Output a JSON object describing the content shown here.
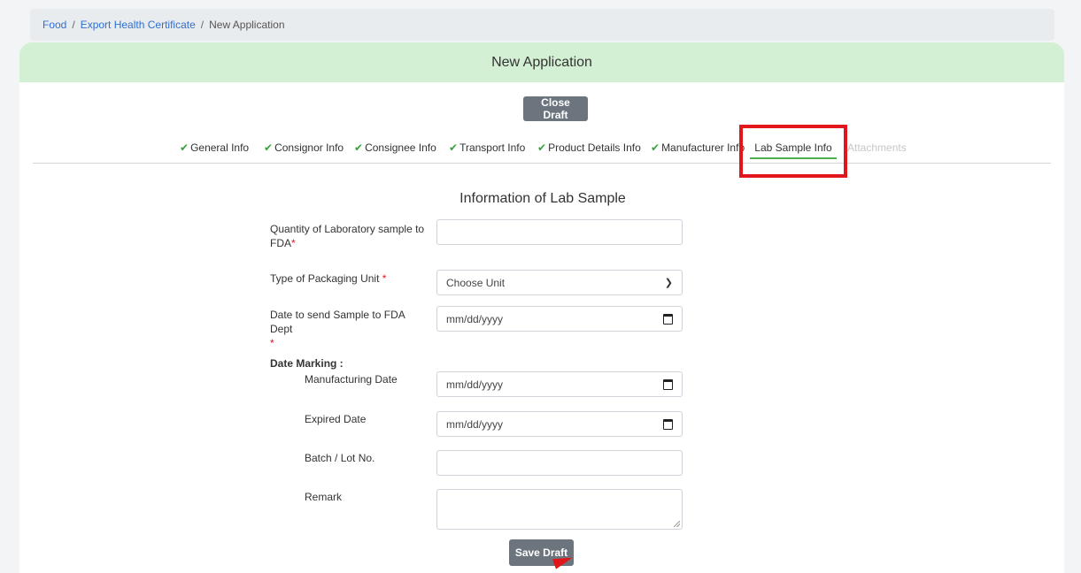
{
  "breadcrumb": {
    "items": [
      "Food",
      "Export Health Certificate"
    ],
    "separator": "/",
    "current": "New Application"
  },
  "header": {
    "title": "New Application"
  },
  "actions": {
    "close_draft_label": "Close Draft",
    "save_draft_label": "Save Draft"
  },
  "tabs": [
    {
      "label": "General Info",
      "completed": true
    },
    {
      "label": "Consignor Info",
      "completed": true
    },
    {
      "label": "Consignee Info",
      "completed": true
    },
    {
      "label": "Transport Info",
      "completed": true
    },
    {
      "label": "Product Details Info",
      "completed": true
    },
    {
      "label": "Manufacturer Info",
      "completed": true
    },
    {
      "label": "Lab Sample Info",
      "active": true
    },
    {
      "label": "Attachments",
      "disabled": true
    }
  ],
  "form": {
    "title": "Information of Lab Sample",
    "required_mark": "*",
    "quantity_label_line1": "Quantity of Laboratory sample to",
    "quantity_label_line2": "FDA",
    "quantity_value": "",
    "packaging_label": "Type of Packaging Unit",
    "packaging_value": "Choose Unit",
    "send_date_label": "Date to send Sample to FDA Dept",
    "send_date_value": "mm/dd/yyyy",
    "date_marking_label": "Date Marking :",
    "manufacturing_date_label": "Manufacturing Date",
    "manufacturing_date_value": "mm/dd/yyyy",
    "expired_date_label": "Expired Date",
    "expired_date_value": "mm/dd/yyyy",
    "batch_label": "Batch / Lot No.",
    "batch_value": "",
    "remark_label": "Remark",
    "remark_value": ""
  },
  "colors": {
    "header_bg": "#d4f0d4",
    "check_green": "#38a13b",
    "highlight_red": "#e0161b",
    "button_gray": "#6c757d",
    "link_blue": "#2f6fd1"
  },
  "icons": [
    "check-icon",
    "chevron-down-icon",
    "calendar-icon"
  ]
}
